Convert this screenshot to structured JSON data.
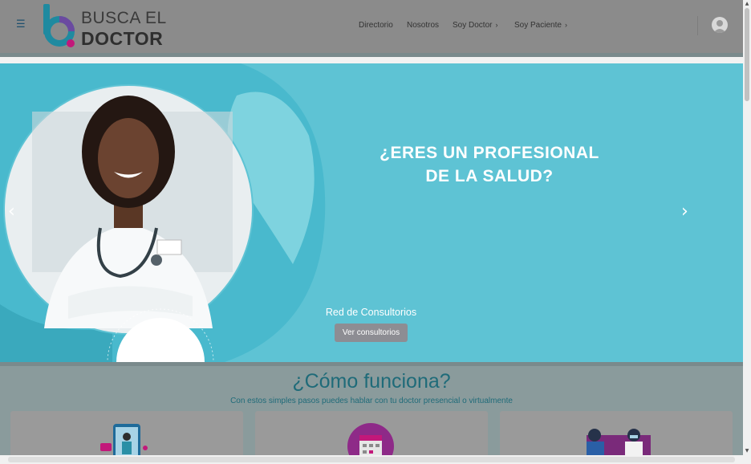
{
  "header": {
    "brand_line1": "BUSCA EL",
    "brand_line2": "DOCTOR",
    "nav": [
      {
        "label": "Directorio",
        "has_chevron": false
      },
      {
        "label": "Nosotros",
        "has_chevron": false
      },
      {
        "label": "Soy Doctor",
        "has_chevron": true
      },
      {
        "label": "Soy Paciente",
        "has_chevron": true
      }
    ],
    "chevron": "›",
    "menu_icon": "☰"
  },
  "hero": {
    "title_line1": "¿ERES UN PROFESIONAL",
    "title_line2": "DE LA SALUD?",
    "caption": "Red de Consultorios",
    "button": "Ver consultorios",
    "prev": "‹",
    "next": "›"
  },
  "how": {
    "title": "¿Cómo funciona?",
    "subtitle": "Con estos simples pasos puedes hablar con tu doctor presencial o virtualmente"
  },
  "colors": {
    "brand_teal": "#1f8aa0",
    "brand_magenta": "#c2187a",
    "hero_bg": "#5ec3d4",
    "section_title": "#1f6b79"
  }
}
